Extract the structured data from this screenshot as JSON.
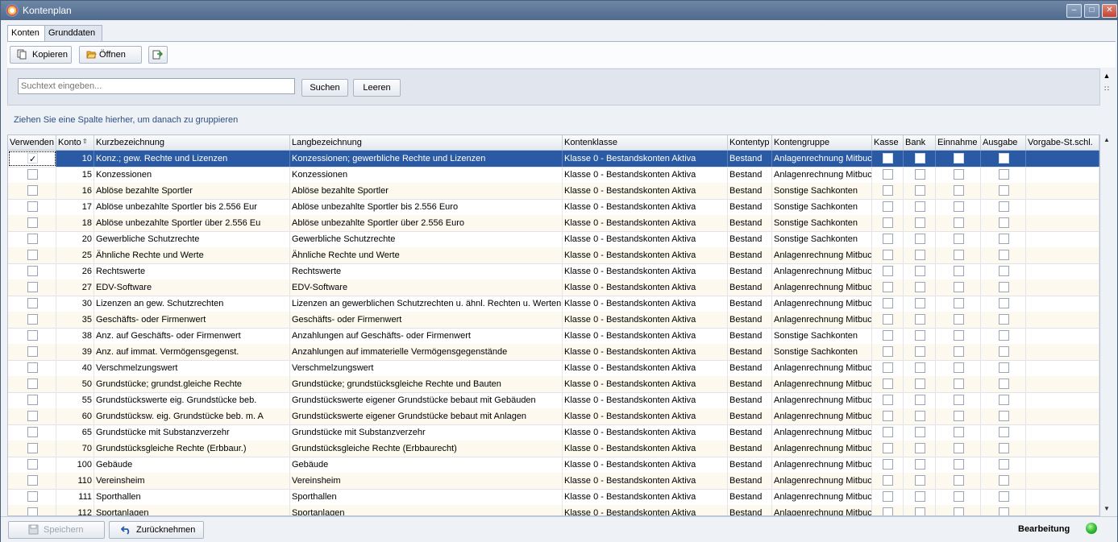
{
  "window": {
    "title": "Kontenplan"
  },
  "tabs": [
    {
      "label": "Konten"
    },
    {
      "label": "Grunddaten"
    }
  ],
  "toolbar": {
    "copy_label": "Kopieren",
    "open_label": "Öffnen"
  },
  "search": {
    "placeholder": "Suchtext eingeben...",
    "search_label": "Suchen",
    "clear_label": "Leeren"
  },
  "group_hint": "Ziehen Sie eine Spalte hierher, um  danach zu gruppieren",
  "columns": [
    "Verwenden",
    "Konto",
    "Kurzbezeichnung",
    "Langbezeichnung",
    "Kontenklasse",
    "Kontentyp",
    "Kontengruppe",
    "Kasse",
    "Bank",
    "Einnahme",
    "Ausgabe",
    "Vorgabe-St.schl."
  ],
  "rows": [
    {
      "use": true,
      "konto": "10",
      "kurz": "Konz.; gew. Rechte und Lizenzen",
      "lang": "Konzessionen; gewerbliche Rechte und Lizenzen",
      "klasse": "Klasse 0 - Bestandskonten Aktiva",
      "typ": "Bestand",
      "gruppe": "Anlagenrechnung Mitbuc",
      "selected": true
    },
    {
      "use": false,
      "konto": "15",
      "kurz": "Konzessionen",
      "lang": "Konzessionen",
      "klasse": "Klasse 0 - Bestandskonten Aktiva",
      "typ": "Bestand",
      "gruppe": "Anlagenrechnung Mitbuc"
    },
    {
      "use": false,
      "konto": "16",
      "kurz": "Ablöse bezahlte Sportler",
      "lang": "Ablöse bezahlte Sportler",
      "klasse": "Klasse 0 - Bestandskonten Aktiva",
      "typ": "Bestand",
      "gruppe": "Sonstige Sachkonten"
    },
    {
      "use": false,
      "konto": "17",
      "kurz": "Ablöse unbezahlte Sportler bis 2.556 Eur",
      "lang": "Ablöse unbezahlte Sportler bis 2.556 Euro",
      "klasse": "Klasse 0 - Bestandskonten Aktiva",
      "typ": "Bestand",
      "gruppe": "Sonstige Sachkonten"
    },
    {
      "use": false,
      "konto": "18",
      "kurz": "Ablöse unbezahlte Sportler über 2.556 Eu",
      "lang": "Ablöse unbezahlte Sportler über 2.556 Euro",
      "klasse": "Klasse 0 - Bestandskonten Aktiva",
      "typ": "Bestand",
      "gruppe": "Sonstige Sachkonten"
    },
    {
      "use": false,
      "konto": "20",
      "kurz": "Gewerbliche Schutzrechte",
      "lang": "Gewerbliche Schutzrechte",
      "klasse": "Klasse 0 - Bestandskonten Aktiva",
      "typ": "Bestand",
      "gruppe": "Sonstige Sachkonten"
    },
    {
      "use": false,
      "konto": "25",
      "kurz": "Ähnliche Rechte und Werte",
      "lang": "Ähnliche Rechte und Werte",
      "klasse": "Klasse 0 - Bestandskonten Aktiva",
      "typ": "Bestand",
      "gruppe": "Anlagenrechnung Mitbuc"
    },
    {
      "use": false,
      "konto": "26",
      "kurz": "Rechtswerte",
      "lang": "Rechtswerte",
      "klasse": "Klasse 0 - Bestandskonten Aktiva",
      "typ": "Bestand",
      "gruppe": "Anlagenrechnung Mitbuc"
    },
    {
      "use": false,
      "konto": "27",
      "kurz": "EDV-Software",
      "lang": "EDV-Software",
      "klasse": "Klasse 0 - Bestandskonten Aktiva",
      "typ": "Bestand",
      "gruppe": "Anlagenrechnung Mitbuc"
    },
    {
      "use": false,
      "konto": "30",
      "kurz": "Lizenzen an gew. Schutzrechten",
      "lang": "Lizenzen an gewerblichen Schutzrechten u. ähnl. Rechten u. Werten",
      "klasse": "Klasse 0 - Bestandskonten Aktiva",
      "typ": "Bestand",
      "gruppe": "Anlagenrechnung Mitbuc"
    },
    {
      "use": false,
      "konto": "35",
      "kurz": "Geschäfts- oder Firmenwert",
      "lang": "Geschäfts- oder Firmenwert",
      "klasse": "Klasse 0 - Bestandskonten Aktiva",
      "typ": "Bestand",
      "gruppe": "Anlagenrechnung Mitbuc"
    },
    {
      "use": false,
      "konto": "38",
      "kurz": "Anz. auf Geschäfts- oder Firmenwert",
      "lang": "Anzahlungen auf Geschäfts- oder Firmenwert",
      "klasse": "Klasse 0 - Bestandskonten Aktiva",
      "typ": "Bestand",
      "gruppe": "Sonstige Sachkonten"
    },
    {
      "use": false,
      "konto": "39",
      "kurz": "Anz. auf immat. Vermögensgegenst.",
      "lang": "Anzahlungen auf immaterielle Vermögensgegenstände",
      "klasse": "Klasse 0 - Bestandskonten Aktiva",
      "typ": "Bestand",
      "gruppe": "Sonstige Sachkonten"
    },
    {
      "use": false,
      "konto": "40",
      "kurz": "Verschmelzungswert",
      "lang": "Verschmelzungswert",
      "klasse": "Klasse 0 - Bestandskonten Aktiva",
      "typ": "Bestand",
      "gruppe": "Anlagenrechnung Mitbuc"
    },
    {
      "use": false,
      "konto": "50",
      "kurz": "Grundstücke; grundst.gleiche Rechte",
      "lang": "Grundstücke; grundstücksgleiche Rechte und Bauten",
      "klasse": "Klasse 0 - Bestandskonten Aktiva",
      "typ": "Bestand",
      "gruppe": "Anlagenrechnung Mitbuc"
    },
    {
      "use": false,
      "konto": "55",
      "kurz": "Grundstückswerte eig. Grundstücke beb.",
      "lang": "Grundstückswerte eigener Grundstücke bebaut mit Gebäuden",
      "klasse": "Klasse 0 - Bestandskonten Aktiva",
      "typ": "Bestand",
      "gruppe": "Anlagenrechnung Mitbuc"
    },
    {
      "use": false,
      "konto": "60",
      "kurz": "Grundstücksw. eig. Grundstücke beb. m. A",
      "lang": "Grundstückswerte eigener Grundstücke bebaut mit Anlagen",
      "klasse": "Klasse 0 - Bestandskonten Aktiva",
      "typ": "Bestand",
      "gruppe": "Anlagenrechnung Mitbuc"
    },
    {
      "use": false,
      "konto": "65",
      "kurz": "Grundstücke mit Substanzverzehr",
      "lang": "Grundstücke mit Substanzverzehr",
      "klasse": "Klasse 0 - Bestandskonten Aktiva",
      "typ": "Bestand",
      "gruppe": "Anlagenrechnung Mitbuc"
    },
    {
      "use": false,
      "konto": "70",
      "kurz": "Grundstücksgleiche Rechte (Erbbaur.)",
      "lang": "Grundstücksgleiche Rechte (Erbbaurecht)",
      "klasse": "Klasse 0 - Bestandskonten Aktiva",
      "typ": "Bestand",
      "gruppe": "Anlagenrechnung Mitbuc"
    },
    {
      "use": false,
      "konto": "100",
      "kurz": "Gebäude",
      "lang": "Gebäude",
      "klasse": "Klasse 0 - Bestandskonten Aktiva",
      "typ": "Bestand",
      "gruppe": "Anlagenrechnung Mitbuc"
    },
    {
      "use": false,
      "konto": "110",
      "kurz": "Vereinsheim",
      "lang": "Vereinsheim",
      "klasse": "Klasse 0 - Bestandskonten Aktiva",
      "typ": "Bestand",
      "gruppe": "Anlagenrechnung Mitbuc"
    },
    {
      "use": false,
      "konto": "111",
      "kurz": "Sporthallen",
      "lang": "Sporthallen",
      "klasse": "Klasse 0 - Bestandskonten Aktiva",
      "typ": "Bestand",
      "gruppe": "Anlagenrechnung Mitbuc"
    },
    {
      "use": false,
      "konto": "112",
      "kurz": "Sportanlagen",
      "lang": "Sportanlagen",
      "klasse": "Klasse 0 - Bestandskonten Aktiva",
      "typ": "Bestand",
      "gruppe": "Anlagenrechnung Mitbuc"
    }
  ],
  "bottom": {
    "save_label": "Speichern",
    "undo_label": "Zurücknehmen",
    "status": "Bearbeitung"
  },
  "colors": {
    "selection": "#2b5aa5",
    "status_led": "#3cc23a",
    "titlebar": "#5b7497"
  }
}
